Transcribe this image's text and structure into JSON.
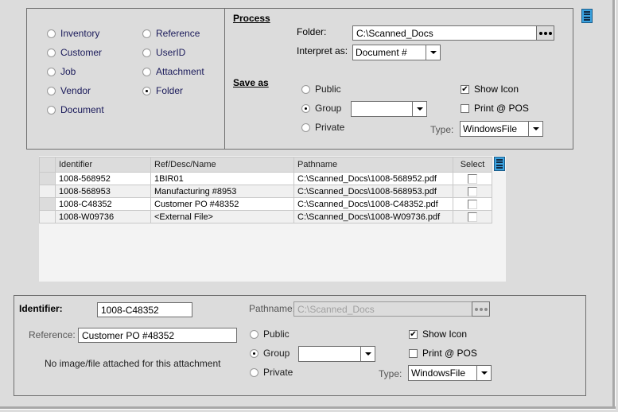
{
  "source_types": [
    {
      "label": "Inventory",
      "selected": false
    },
    {
      "label": "Customer",
      "selected": false
    },
    {
      "label": "Job",
      "selected": false
    },
    {
      "label": "Vendor",
      "selected": false
    },
    {
      "label": "Document",
      "selected": false
    },
    {
      "label": "Reference",
      "selected": false
    },
    {
      "label": "UserID",
      "selected": false
    },
    {
      "label": "Attachment",
      "selected": false
    },
    {
      "label": "Folder",
      "selected": true
    }
  ],
  "process": {
    "title": "Process",
    "folder_label": "Folder:",
    "folder_value": "C:\\Scanned_Docs",
    "interpret_label": "Interpret as:",
    "interpret_value": "Document #"
  },
  "save_as": {
    "title": "Save as",
    "public_label": "Public",
    "group_label": "Group",
    "private_label": "Private",
    "selected": "Group",
    "group_value": "",
    "show_icon_label": "Show Icon",
    "show_icon_checked": true,
    "print_pos_label": "Print @ POS",
    "print_pos_checked": false,
    "type_label": "Type:",
    "type_value": "WindowsFile"
  },
  "grid": {
    "columns": [
      "Identifier",
      "Ref/Desc/Name",
      "Pathname",
      "Select"
    ],
    "rows": [
      {
        "identifier": "1008-568952",
        "ref": "1BIR01",
        "pathname": "C:\\Scanned_Docs\\1008-568952.pdf",
        "selected": false
      },
      {
        "identifier": "1008-568953",
        "ref": "Manufacturing #8953",
        "pathname": "C:\\Scanned_Docs\\1008-568953.pdf",
        "selected": false
      },
      {
        "identifier": "1008-C48352",
        "ref": "Customer PO #48352",
        "pathname": "C:\\Scanned_Docs\\1008-C48352.pdf",
        "selected": false
      },
      {
        "identifier": "1008-W09736",
        "ref": "<External File>",
        "pathname": "C:\\Scanned_Docs\\1008-W09736.pdf",
        "selected": false
      }
    ]
  },
  "detail": {
    "identifier_label": "Identifier:",
    "identifier_value": "1008-C48352",
    "reference_label": "Reference:",
    "reference_value": "Customer PO #48352",
    "no_image_text": "No image/file attached for this attachment",
    "pathname_label": "Pathname:",
    "pathname_value": "C:\\Scanned_Docs",
    "public_label": "Public",
    "group_label": "Group",
    "private_label": "Private",
    "selected": "Group",
    "group_value": "",
    "show_icon_label": "Show Icon",
    "show_icon_checked": true,
    "print_pos_label": "Print @ POS",
    "print_pos_checked": false,
    "type_label": "Type:",
    "type_value": "WindowsFile"
  },
  "icons": {
    "check_mark": "✔"
  }
}
